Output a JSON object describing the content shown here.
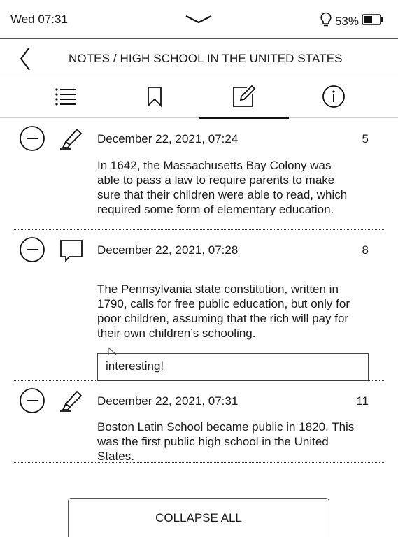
{
  "status": {
    "time": "Wed 07:31",
    "battery": "53%",
    "battery_level": 0.53,
    "icons": [
      "chevron-down-icon",
      "bulb-icon",
      "battery-icon"
    ]
  },
  "header": {
    "back_icon": "back-arrow-icon",
    "title": "NOTES / HIGH SCHOOL IN THE UNITED STATES"
  },
  "tabs": [
    {
      "icon": "contents-list-icon",
      "active": false
    },
    {
      "icon": "bookmark-icon",
      "active": false
    },
    {
      "icon": "notes-edit-icon",
      "active": true
    },
    {
      "icon": "info-icon",
      "active": false
    }
  ],
  "notes": [
    {
      "type": "highlight",
      "type_icon": "highlighter-icon",
      "date": "December 22, 2021, 07:24",
      "page": "5",
      "text": "In 1642, the Massachusetts Bay Colony was able to pass a law to require parents to make sure that their children were able to read, which required some form of elementary education."
    },
    {
      "type": "comment",
      "type_icon": "comment-icon",
      "date": "December 22, 2021, 07:28",
      "page": "8",
      "text": "The Pennsylvania state constitution, written in 1790, calls for free public education, but only for poor children, assuming that the rich will pay for their own children’s schooling.",
      "comment": "interesting!"
    },
    {
      "type": "highlight",
      "type_icon": "highlighter-icon",
      "date": "December 22, 2021, 07:31",
      "page": "11",
      "text": "Boston Latin School became public in 1820. This was the first public high school in the United States."
    }
  ],
  "footer": {
    "collapse_label": "COLLAPSE ALL"
  }
}
